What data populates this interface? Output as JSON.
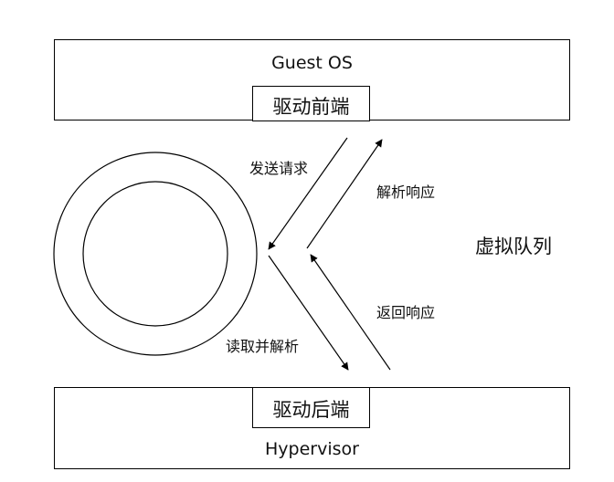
{
  "guest_os": {
    "title": "Guest OS",
    "frontend_driver": "驱动前端"
  },
  "hypervisor": {
    "title": "Hypervisor",
    "backend_driver": "驱动后端"
  },
  "virtqueue_label": "虚拟队列",
  "arrows": {
    "send_request": "发送请求",
    "parse_response": "解析响应",
    "read_and_parse": "读取并解析",
    "return_response": "返回响应"
  }
}
